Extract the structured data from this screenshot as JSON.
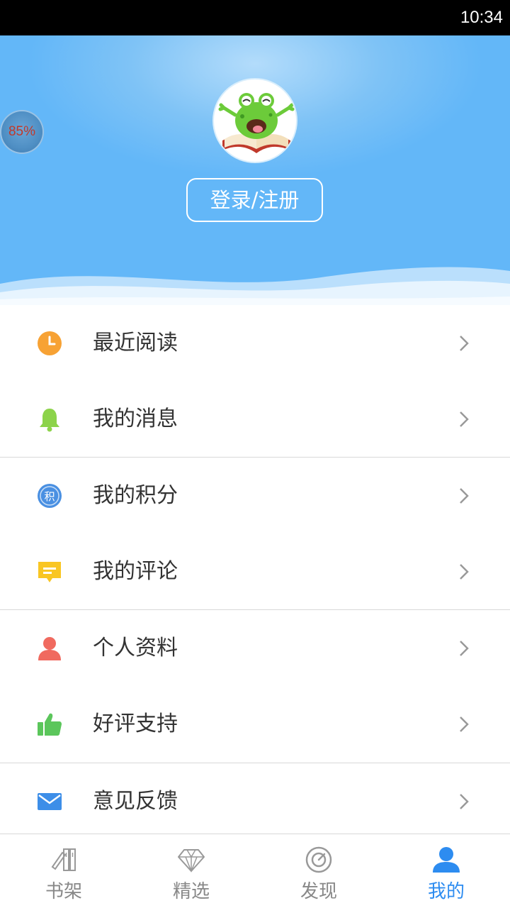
{
  "status_bar": {
    "time": "10:34"
  },
  "floating_badge": {
    "text": "85%"
  },
  "header": {
    "login_label": "登录/注册"
  },
  "menu": {
    "items": [
      {
        "label": "最近阅读",
        "icon": "clock-icon"
      },
      {
        "label": "我的消息",
        "icon": "bell-icon"
      },
      {
        "label": "我的积分",
        "icon": "points-icon",
        "icon_glyph": "积"
      },
      {
        "label": "我的评论",
        "icon": "comment-icon"
      },
      {
        "label": "个人资料",
        "icon": "user-icon"
      },
      {
        "label": "好评支持",
        "icon": "thumbs-up-icon"
      },
      {
        "label": "意见反馈",
        "icon": "mail-icon"
      }
    ]
  },
  "bottom_nav": {
    "tabs": [
      {
        "label": "书架",
        "icon": "bookshelf-icon",
        "active": false
      },
      {
        "label": "精选",
        "icon": "diamond-icon",
        "active": false
      },
      {
        "label": "发现",
        "icon": "compass-icon",
        "active": false
      },
      {
        "label": "我的",
        "icon": "profile-icon",
        "active": true
      }
    ]
  },
  "colors": {
    "header_blue": "#63b7f8",
    "active_blue": "#2d8cf0",
    "clock_orange": "#f7a234",
    "bell_green": "#8cd34a",
    "points_blue": "#4a90e2",
    "comment_yellow": "#f9c623",
    "user_red": "#f06a5f",
    "thumb_green": "#5bc65b",
    "mail_blue": "#3d8ee8"
  }
}
